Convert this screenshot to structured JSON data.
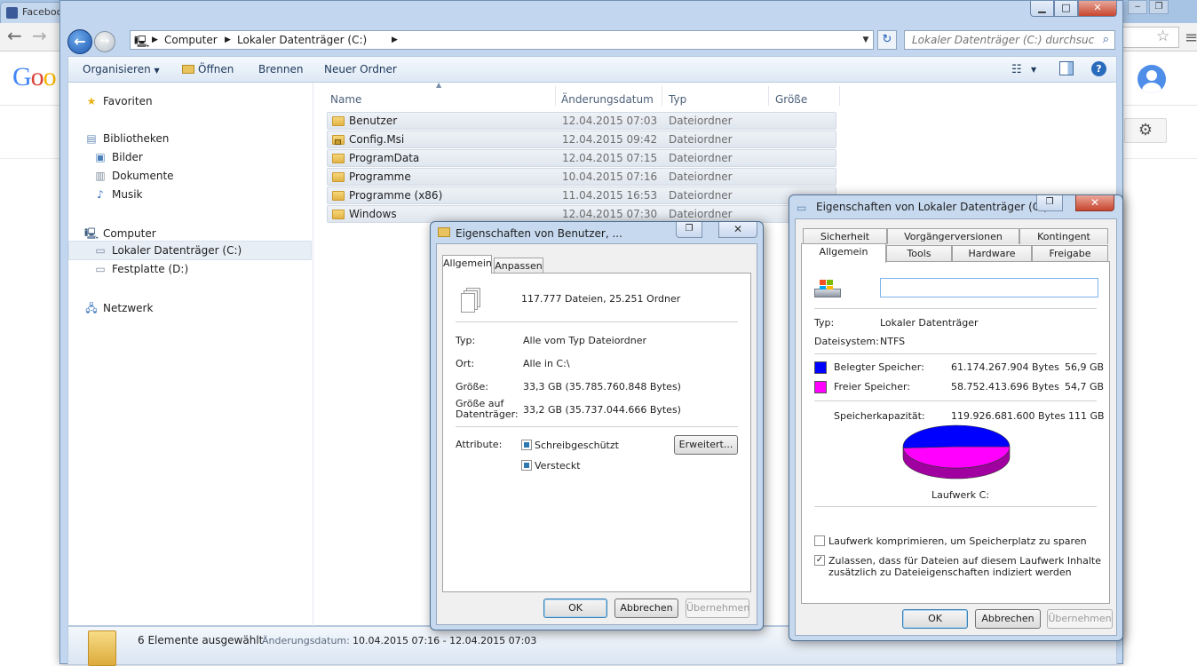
{
  "browser": {
    "tabs": [
      "Facebook"
    ],
    "logo_text": [
      "G",
      "o",
      "o"
    ]
  },
  "explorer": {
    "address": {
      "crumbs": [
        "Computer",
        "Lokaler Datenträger (C:)"
      ],
      "search_placeholder": "Lokaler Datenträger (C:) durchsuchen"
    },
    "commands": {
      "organize": "Organisieren",
      "open": "Öffnen",
      "burn": "Brennen",
      "new_folder": "Neuer Ordner"
    },
    "nav": {
      "favorites": "Favoriten",
      "libraries": "Bibliotheken",
      "pictures": "Bilder",
      "documents": "Dokumente",
      "music": "Musik",
      "computer": "Computer",
      "drive_c": "Lokaler Datenträger (C:)",
      "drive_d": "Festplatte (D:)",
      "network": "Netzwerk"
    },
    "columns": {
      "name": "Name",
      "date": "Änderungsdatum",
      "type": "Typ",
      "size": "Größe"
    },
    "files": [
      {
        "name": "Benutzer",
        "date": "12.04.2015 07:03",
        "type": "Dateiordner"
      },
      {
        "name": "Config.Msi",
        "date": "12.04.2015 09:42",
        "type": "Dateiordner"
      },
      {
        "name": "ProgramData",
        "date": "12.04.2015 07:15",
        "type": "Dateiordner"
      },
      {
        "name": "Programme",
        "date": "10.04.2015 07:16",
        "type": "Dateiordner"
      },
      {
        "name": "Programme (x86)",
        "date": "11.04.2015 16:53",
        "type": "Dateiordner"
      },
      {
        "name": "Windows",
        "date": "12.04.2015 07:30",
        "type": "Dateiordner"
      }
    ],
    "status": {
      "selected": "6 Elemente ausgewählt",
      "date_label": "Änderungsdatum:",
      "date_range": "10.04.2015 07:16 - 12.04.2015 07:03"
    }
  },
  "folder_dialog": {
    "title": "Eigenschaften von Benutzer, ...",
    "tabs": [
      "Allgemein",
      "Anpassen"
    ],
    "summary": "117.777 Dateien, 25.251 Ordner",
    "type_label": "Typ:",
    "type_value": "Alle vom Typ Dateiordner",
    "location_label": "Ort:",
    "location_value": "Alle in C:\\",
    "size_label": "Größe:",
    "size_value": "33,3 GB (35.785.760.848 Bytes)",
    "disk_size_label_1": "Größe auf",
    "disk_size_label_2": "Datenträger:",
    "disk_size_value": "33,2 GB (35.737.044.666 Bytes)",
    "attributes_label": "Attribute:",
    "readonly_label": "Schreibgeschützt",
    "hidden_label": "Versteckt",
    "advanced_button": "Erweitert...",
    "ok": "OK",
    "cancel": "Abbrechen",
    "apply": "Übernehmen"
  },
  "drive_dialog": {
    "title": "Eigenschaften von Lokaler Datenträger (C:)",
    "tabs_top": [
      "Sicherheit",
      "Vorgängerversionen",
      "Kontingent"
    ],
    "tabs_bottom": [
      "Allgemein",
      "Tools",
      "Hardware",
      "Freigabe"
    ],
    "label_value": "",
    "type_label": "Typ:",
    "type_value": "Lokaler Datenträger",
    "fs_label": "Dateisystem:",
    "fs_value": "NTFS",
    "used_label": "Belegter Speicher:",
    "used_bytes": "61.174.267.904 Bytes",
    "used_gb": "56,9 GB",
    "free_label": "Freier Speicher:",
    "free_bytes": "58.752.413.696 Bytes",
    "free_gb": "54,7 GB",
    "capacity_label": "Speicherkapazität:",
    "capacity_bytes": "119.926.681.600 Bytes",
    "capacity_gb": "111 GB",
    "drive_caption": "Laufwerk C:",
    "compress_label": "Laufwerk komprimieren, um Speicherplatz zu sparen",
    "index_label_1": "Zulassen, dass für Dateien auf diesem Laufwerk Inhalte",
    "index_label_2": "zusätzlich zu Dateieigenschaften indiziert werden",
    "ok": "OK",
    "cancel": "Abbrechen",
    "apply": "Übernehmen",
    "used_fraction": 0.51,
    "colors": {
      "used": "#0000ff",
      "free": "#ff00ff"
    }
  }
}
